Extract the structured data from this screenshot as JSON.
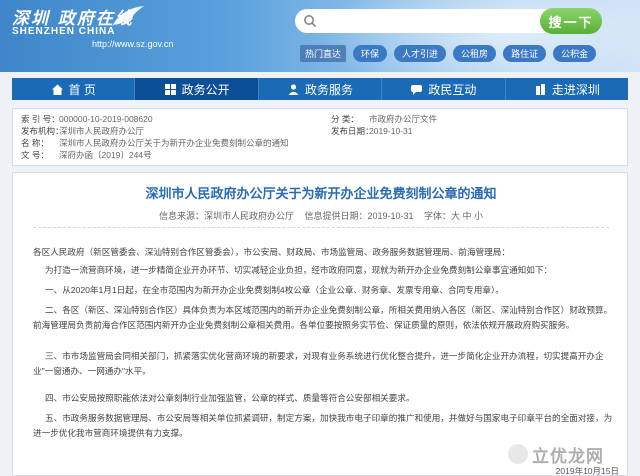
{
  "header": {
    "logo_cn": "深圳 政府在线",
    "logo_en": "SHENZHEN CHINA",
    "logo_url": "http://www.sz.gov.cn",
    "search_placeholder": "",
    "search_button": "搜一下",
    "quick_label": "热门直达",
    "quick_links": [
      "环保",
      "人才引进",
      "公租房",
      "路住证",
      "公积金"
    ]
  },
  "nav": {
    "items": [
      {
        "label": "首 页",
        "icon": "home-icon",
        "active": false
      },
      {
        "label": "政务公开",
        "icon": "grid-icon",
        "active": true
      },
      {
        "label": "政务服务",
        "icon": "people-icon",
        "active": false
      },
      {
        "label": "政民互动",
        "icon": "chat-icon",
        "active": false
      },
      {
        "label": "走进深圳",
        "icon": "building-icon",
        "active": false
      }
    ]
  },
  "meta": {
    "index_key": "索 引 号：",
    "index_val": "000000-10-2019-008620",
    "org_key": "发布机构：",
    "org_val": "深圳市人民政府办公厅",
    "name_key": "名 称：",
    "name_val": "深圳市人民政府办公厅关于为新开办企业免费刻制公章的通知",
    "doc_key": "文 号：",
    "doc_val": "深府办函〔2019〕244号",
    "cat_key": "分 类：",
    "cat_val": "市政府办公厅文件",
    "date_key": "发布日期：",
    "date_val": "2019-10-31"
  },
  "doc": {
    "title": "深圳市人民政府办公厅关于为新开办企业免费刻制公章的通知",
    "source": "信息来源：深圳市人民政府办公厅",
    "pubtime": "信息提供日期：2019-10-31",
    "fontsize": "字体：大 中 小",
    "paragraphs": [
      "各区人民政府（新区管委会、深汕特别合作区管委会），市公安局、财政局、市场监管局、政务服务数据管理局、前海管理局：",
      "为打造一流营商环境，进一步精简企业开办环节、切实减轻企业负担，经市政府同意，现就为新开办企业免费刻制公章事宜通知如下：",
      "一、从2020年1月1日起，在全市范围内为新开办企业免费刻制4枚公章（企业公章、财务章、发票专用章、合同专用章）。",
      "二、各区（新区、深汕特别合作区）具体负责为本区域范围内的新开办企业免费刻制公章，所相关费用纳入各区（新区、深汕特别合作区）财政预算。前海管理局负责前海合作区范围内新开办企业免费刻制公章相关费用。各单位要按照务实节俭、保证质量的原则，依法依规开展政府购买服务。",
      "三、市市场监管局会同相关部门，抓紧落实优化营商环境的新要求，对现有业务系统进行优化整合提升，进一步简化企业开办流程，切实提高开办企业\"一窗通办、一网通办\"水平。",
      "四、市公安局按照职能依法对公章刻制行业加强监管，公章的样式、质量等符合公安部相关要求。",
      "五、市政务服务数据管理局、市公安局等相关单位抓紧调研，制定方案，加快我市电子印章的推广和使用，并做好与国家电子印章平台的全面对接，为进一步优化我市营商环境提供有力支撑。"
    ],
    "date_foot": "2019年10月15日"
  },
  "watermark": {
    "text": "立优龙网"
  }
}
